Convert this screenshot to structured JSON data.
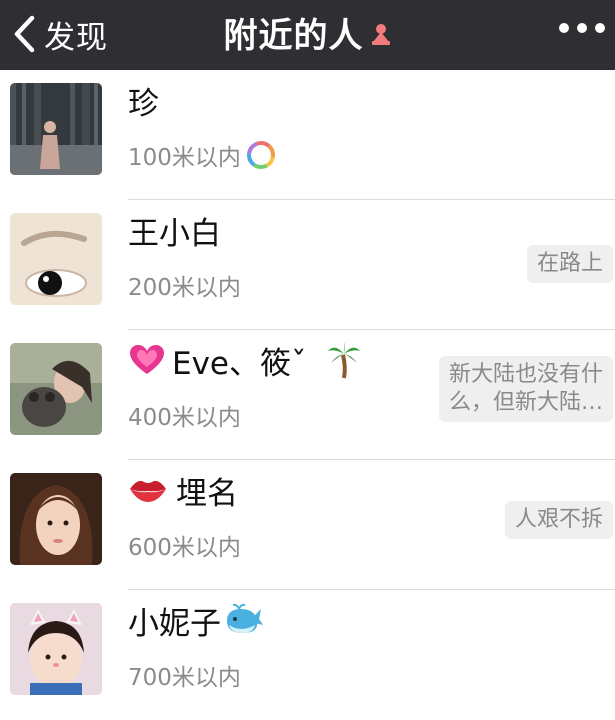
{
  "nav": {
    "back_label": "发现",
    "title": "附近的人",
    "gender_icon": "female-pin-icon",
    "more_icon": "more-dots-icon"
  },
  "people": [
    {
      "name": "珍",
      "distance": "100米以内",
      "album_icon": "moments-album-icon",
      "signature": ""
    },
    {
      "name": "王小白",
      "distance": "200米以内",
      "signature": "在路上"
    },
    {
      "name_prefix_icon": "pink-heart-emoji",
      "name": "Eve、筱ˇ",
      "name_suffix_icon": "palm-tree-emoji",
      "distance": "400米以内",
      "signature_line1": "新大陆也没有什",
      "signature_line2": "么，但新大陆…"
    },
    {
      "name_prefix_icon": "lips-emoji",
      "name": "埋名",
      "distance": "600米以内",
      "signature": "人艰不拆"
    },
    {
      "name": "小妮子",
      "name_suffix_icon": "whale-emoji",
      "distance": "700米以内",
      "signature": ""
    }
  ],
  "colors": {
    "nav_bg": "#2e2e33",
    "nav_text": "#ffffff",
    "secondary_text": "#8b8b8b",
    "signature_bg": "#efefef"
  }
}
